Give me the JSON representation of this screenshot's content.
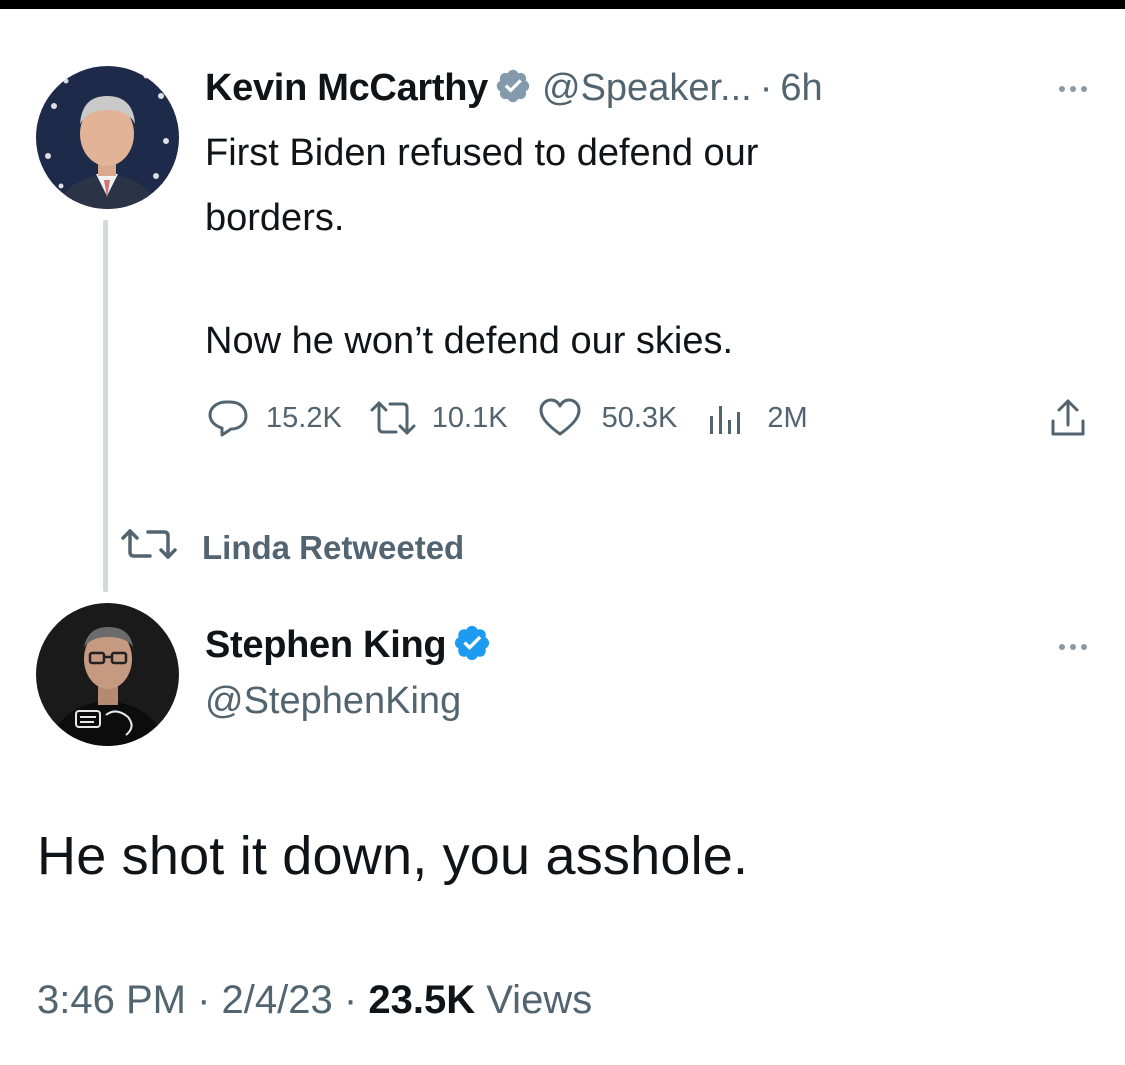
{
  "original_tweet": {
    "author_name": "Kevin McCarthy",
    "handle": "@Speaker...",
    "separator": "·",
    "time_ago": "6h",
    "text_lines": [
      "First Biden refused to defend our",
      "borders.",
      "Now he won’t defend our skies."
    ],
    "stats": {
      "replies": "15.2K",
      "retweets": "10.1K",
      "likes": "50.3K",
      "views": "2M"
    }
  },
  "retweet_banner": {
    "label": "Linda Retweeted"
  },
  "reply_tweet": {
    "author_name": "Stephen King",
    "handle": "@StephenKing",
    "text": "He shot it down, you asshole.",
    "time": "3:46 PM",
    "sep1": "·",
    "date": "2/4/23",
    "sep2": "·",
    "views_count": "23.5K",
    "views_label": "Views"
  },
  "icons": {
    "verified": "verified-badge-icon",
    "reply": "reply-icon",
    "retweet": "retweet-icon",
    "like": "heart-icon",
    "views": "views-chart-icon",
    "share": "share-icon",
    "more": "more-options-icon"
  },
  "colors": {
    "verified_blue": "#1d9bf0",
    "verified_gray": "#829aab",
    "secondary_text": "#536471",
    "thread_line": "#cfd9de"
  }
}
